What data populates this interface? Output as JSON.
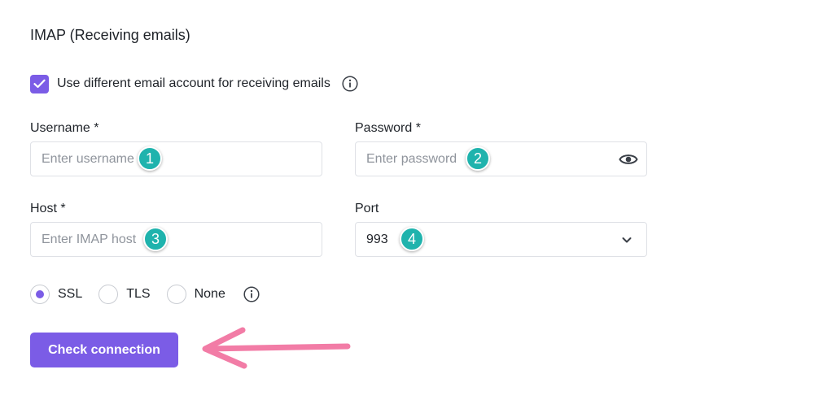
{
  "section": {
    "title": "IMAP (Receiving emails)"
  },
  "checkbox": {
    "label": "Use different email account for receiving emails",
    "checked": true
  },
  "username": {
    "label": "Username *",
    "placeholder": "Enter username",
    "marker": "1"
  },
  "password": {
    "label": "Password *",
    "placeholder": "Enter password",
    "marker": "2"
  },
  "host": {
    "label": "Host *",
    "placeholder": "Enter IMAP host",
    "marker": "3"
  },
  "port": {
    "label": "Port",
    "value": "993",
    "marker": "4"
  },
  "encryption": {
    "options": [
      {
        "label": "SSL",
        "checked": true
      },
      {
        "label": "TLS",
        "checked": false
      },
      {
        "label": "None",
        "checked": false
      }
    ]
  },
  "button": {
    "label": "Check connection"
  },
  "colors": {
    "accent": "#7b5ce6",
    "marker": "#1fb3ad",
    "arrow": "#f27ca6"
  },
  "icons": [
    "check-icon",
    "info-icon",
    "eye-icon",
    "chevron-down-icon",
    "arrow-left-icon"
  ]
}
